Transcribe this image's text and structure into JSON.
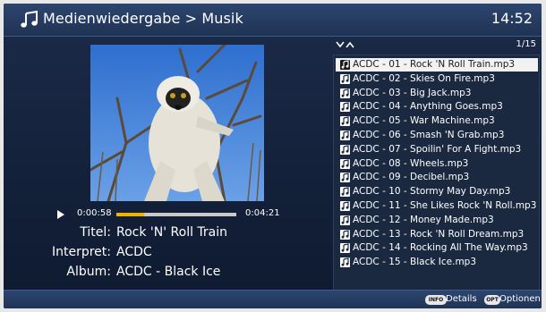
{
  "header": {
    "title": "Medienwiedergabe > Musik",
    "clock": "14:52",
    "icon": "music-note-icon"
  },
  "player": {
    "elapsed": "0:00:58",
    "total": "0:04:21",
    "progress_fraction": 0.23,
    "play_icon": "play-icon"
  },
  "track_info": {
    "title_label": "Titel:",
    "title_value": "Rock 'N' Roll Train",
    "artist_label": "Interpret:",
    "artist_value": "ACDC",
    "album_label": "Album:",
    "album_value": "ACDC - Black Ice"
  },
  "playlist": {
    "page": "1/15",
    "sort_icon": "chevron-down-up-icon",
    "selected_index": 0,
    "items": [
      "ACDC - 01 - Rock 'N Roll Train.mp3",
      "ACDC - 02 - Skies On Fire.mp3",
      "ACDC - 03 - Big Jack.mp3",
      "ACDC - 04 - Anything Goes.mp3",
      "ACDC - 05 - War Machine.mp3",
      "ACDC - 06 - Smash 'N Grab.mp3",
      "ACDC - 07 - Spoilin' For A Fight.mp3",
      "ACDC - 08 - Wheels.mp3",
      "ACDC - 09 - Decibel.mp3",
      "ACDC - 10 - Stormy May Day.mp3",
      "ACDC - 11 - She Likes Rock 'N Roll.mp3",
      "ACDC - 12 - Money Made.mp3",
      "ACDC - 13 - Rock 'N Roll Dream.mp3",
      "ACDC - 14 - Rocking All The Way.mp3",
      "ACDC - 15 - Black Ice.mp3"
    ]
  },
  "footer": {
    "info_key": "INFO",
    "details_label": "Details",
    "opt_key": "OPT",
    "options_label": "Optionen"
  },
  "colors": {
    "accent_progress": "#f0b400",
    "background": "#14213a",
    "selected_row": "#f2f2f2"
  }
}
